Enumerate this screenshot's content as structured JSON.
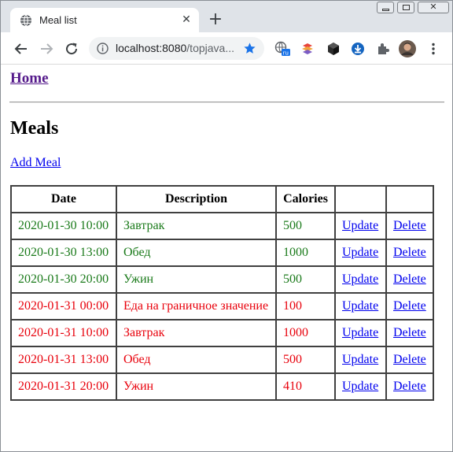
{
  "browser": {
    "tab_title": "Meal list",
    "url_host": "localhost:8080",
    "url_rest": "/topjava...",
    "colors": {
      "star": "#1a73e8",
      "tabstrip": "#dfe3e8"
    }
  },
  "page": {
    "home_link": "Home",
    "heading": "Meals",
    "add_link": "Add Meal",
    "table": {
      "headers": [
        "Date",
        "Description",
        "Calories",
        "",
        ""
      ],
      "update_label": "Update",
      "delete_label": "Delete",
      "rows": [
        {
          "date": "2020-01-30 10:00",
          "description": "Завтрак",
          "calories": "500",
          "excess": false
        },
        {
          "date": "2020-01-30 13:00",
          "description": "Обед",
          "calories": "1000",
          "excess": false
        },
        {
          "date": "2020-01-30 20:00",
          "description": "Ужин",
          "calories": "500",
          "excess": false
        },
        {
          "date": "2020-01-31 00:00",
          "description": "Еда на граничное значение",
          "calories": "100",
          "excess": true
        },
        {
          "date": "2020-01-31 10:00",
          "description": "Завтрак",
          "calories": "1000",
          "excess": true
        },
        {
          "date": "2020-01-31 13:00",
          "description": "Обед",
          "calories": "500",
          "excess": true
        },
        {
          "date": "2020-01-31 20:00",
          "description": "Ужин",
          "calories": "410",
          "excess": true
        }
      ]
    },
    "colors": {
      "normal": "#1a7a1a",
      "excess": "#e8000b",
      "link": "#0000ee",
      "visited": "#551a8b"
    }
  }
}
